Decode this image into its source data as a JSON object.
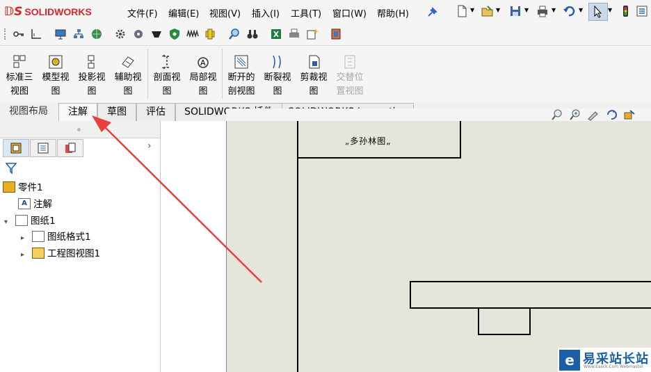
{
  "app": {
    "logo_ds": "𝔻S",
    "logo_text": "SOLIDWORKS"
  },
  "menu": [
    "文件(F)",
    "编辑(E)",
    "视图(V)",
    "插入(I)",
    "工具(T)",
    "窗口(W)",
    "帮助(H)"
  ],
  "ribbon": {
    "buttons": [
      {
        "line1": "标准三",
        "line2": "视图",
        "icon": "standard-3-view-icon",
        "enabled": true
      },
      {
        "line1": "模型视",
        "line2": "图",
        "icon": "model-view-icon",
        "enabled": true
      },
      {
        "line1": "投影视",
        "line2": "图",
        "icon": "projected-view-icon",
        "enabled": true
      },
      {
        "line1": "辅助视",
        "line2": "图",
        "icon": "auxiliary-view-icon",
        "enabled": true
      },
      {
        "line1": "剖面视",
        "line2": "图",
        "icon": "section-view-icon",
        "enabled": true
      },
      {
        "line1": "局部视",
        "line2": "图",
        "icon": "detail-view-icon",
        "enabled": true
      },
      {
        "line1": "断开的",
        "line2": "剖视图",
        "icon": "broken-out-section-icon",
        "enabled": true
      },
      {
        "line1": "断裂视",
        "line2": "图",
        "icon": "break-view-icon",
        "enabled": true
      },
      {
        "line1": "剪裁视",
        "line2": "图",
        "icon": "crop-view-icon",
        "enabled": true
      },
      {
        "line1": "交替位",
        "line2": "置视图",
        "icon": "alternate-position-view-icon",
        "enabled": false
      }
    ]
  },
  "tabs": [
    "视图布局",
    "注解",
    "草图",
    "评估",
    "SOLIDWORKS 插件",
    "SOLIDWORKS Inspection"
  ],
  "tree": {
    "root": "零件1",
    "items": [
      {
        "label": "注解",
        "indent": 1,
        "expander": ""
      },
      {
        "label": "图纸1",
        "indent": 1,
        "expander": "▾"
      },
      {
        "label": "图纸格式1",
        "indent": 2,
        "expander": "▸"
      },
      {
        "label": "工程图视图1",
        "indent": 2,
        "expander": "▸"
      }
    ]
  },
  "sheet": {
    "title_block_text": "„多孙林图„"
  },
  "watermark": {
    "title": "易采站长站",
    "subtitle": "Www.Easck.Com  Webmaster"
  },
  "colors": {
    "accent_red": "#d9262b",
    "arrow_red": "#e8403c",
    "sheet_bg": "#e6e5dc"
  }
}
